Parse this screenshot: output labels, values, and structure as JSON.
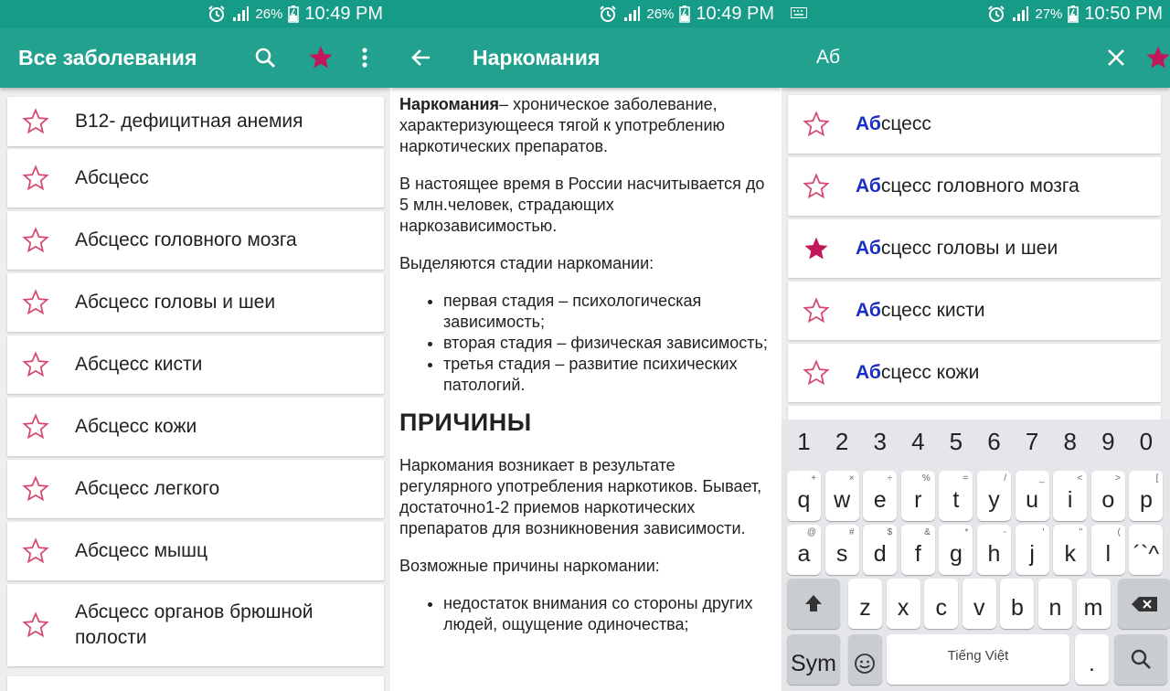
{
  "colors": {
    "primary": "#21a18e",
    "status": "#169b87",
    "star_outline": "#d7486e",
    "star_filled": "#c2185b",
    "highlight": "#1a2fc7"
  },
  "panel1": {
    "status": {
      "battery": "26%",
      "time": "10:49 PM"
    },
    "title": "Все заболевания",
    "items": [
      {
        "label": "B12- дефицитная анемия",
        "favorite": false
      },
      {
        "label": "Абсцесс",
        "favorite": false
      },
      {
        "label": "Абсцесс головного мозга",
        "favorite": false
      },
      {
        "label": "Абсцесс головы и шеи",
        "favorite": false
      },
      {
        "label": "Абсцесс кисти",
        "favorite": false
      },
      {
        "label": "Абсцесс кожи",
        "favorite": false
      },
      {
        "label": "Абсцесс легкого",
        "favorite": false
      },
      {
        "label": "Абсцесс мышц",
        "favorite": false
      },
      {
        "label": "Абсцесс органов брюшной полости",
        "favorite": false
      }
    ]
  },
  "panel2": {
    "status": {
      "battery": "26%",
      "time": "10:49 PM"
    },
    "title": "Наркомания",
    "article": {
      "p1_bold": "Наркомания",
      "p1_rest": "– хроническое заболевание, характеризующееся тягой к употреблению наркотических препаратов.",
      "p2": "В настоящее время в России насчитывается до 5 млн.человек, страдающих наркозависимостью.",
      "p3": "Выделяются стадии наркомании:",
      "stages": [
        "первая стадия – психологическая зависимость;",
        "вторая стадия – физическая зависимость;",
        "третья стадия – развитие психических патологий."
      ],
      "heading": "ПРИЧИНЫ",
      "p4": "Наркомания возникает в результате регулярного употребления наркотиков. Бывает, достаточно1-2 приемов наркотических препаратов для возникновения зависимости.",
      "p5": "Возможные причины наркомании:",
      "causes": [
        "недостаток внимания со стороны других людей, ощущение одиночества;"
      ]
    }
  },
  "panel3": {
    "status": {
      "battery": "27%",
      "time": "10:50 PM"
    },
    "query": "Аб",
    "results": [
      {
        "match": "Аб",
        "rest": "сцесс",
        "favorite": false
      },
      {
        "match": "Аб",
        "rest": "сцесс головного мозга",
        "favorite": false
      },
      {
        "match": "Аб",
        "rest": "сцесс головы и шеи",
        "favorite": true
      },
      {
        "match": "Аб",
        "rest": "сцесс кисти",
        "favorite": false
      },
      {
        "match": "Аб",
        "rest": "сцесс кожи",
        "favorite": false
      }
    ],
    "keyboard": {
      "numbers": [
        "1",
        "2",
        "3",
        "4",
        "5",
        "6",
        "7",
        "8",
        "9",
        "0"
      ],
      "row1": [
        {
          "k": "q",
          "s": "+"
        },
        {
          "k": "w",
          "s": "×"
        },
        {
          "k": "e",
          "s": "÷"
        },
        {
          "k": "r",
          "s": "%"
        },
        {
          "k": "t",
          "s": "="
        },
        {
          "k": "y",
          "s": "/"
        },
        {
          "k": "u",
          "s": "_"
        },
        {
          "k": "i",
          "s": "<"
        },
        {
          "k": "o",
          "s": ">"
        },
        {
          "k": "p",
          "s": "["
        }
      ],
      "row2": [
        {
          "k": "a",
          "s": "@"
        },
        {
          "k": "s",
          "s": "#"
        },
        {
          "k": "d",
          "s": "$"
        },
        {
          "k": "f",
          "s": "&"
        },
        {
          "k": "g",
          "s": "*"
        },
        {
          "k": "h",
          "s": "-"
        },
        {
          "k": "j",
          "s": "'"
        },
        {
          "k": "k",
          "s": "\""
        },
        {
          "k": "l",
          "s": "("
        },
        {
          "k": "´`^",
          "s": ""
        }
      ],
      "row3": [
        {
          "k": "z",
          "s": ""
        },
        {
          "k": "x",
          "s": ""
        },
        {
          "k": "c",
          "s": ""
        },
        {
          "k": "v",
          "s": ""
        },
        {
          "k": "b",
          "s": ""
        },
        {
          "k": "n",
          "s": ""
        },
        {
          "k": "m",
          "s": ""
        }
      ],
      "sym": "Sym",
      "space": "Tiếng Việt",
      "period": "."
    }
  }
}
